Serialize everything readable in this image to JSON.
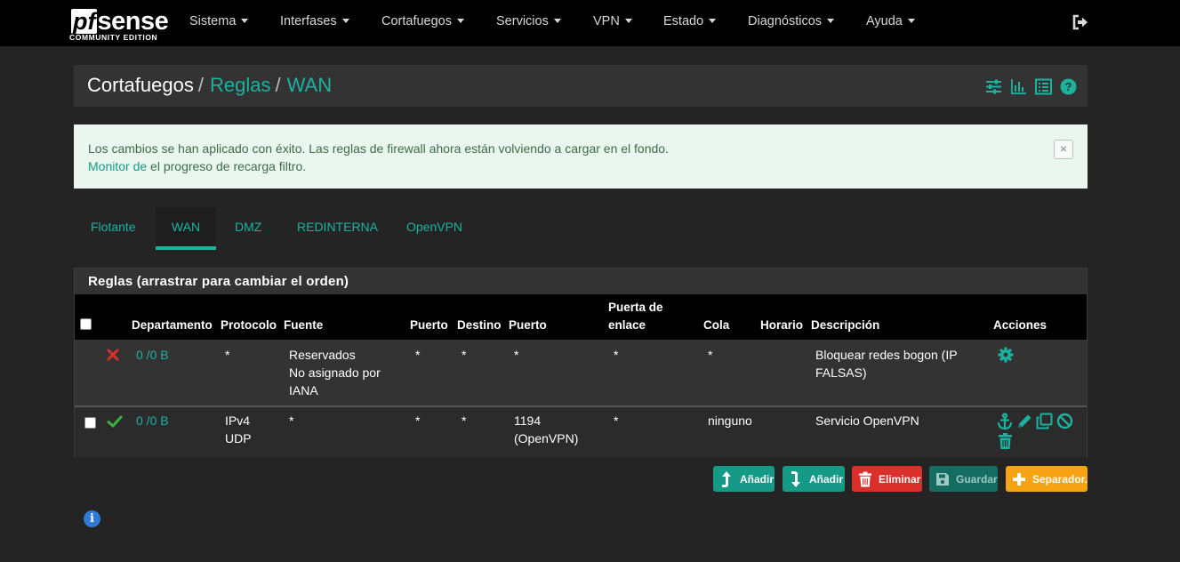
{
  "brand": {
    "logo_pf": "pf",
    "logo_sense": "sense",
    "edition": "COMMUNITY EDITION"
  },
  "nav": {
    "items": [
      "Sistema",
      "Interfases",
      "Cortafuegos",
      "Servicios",
      "VPN",
      "Estado",
      "Diagnósticos",
      "Ayuda"
    ],
    "logout_icon": "logout-icon"
  },
  "breadcrumb": {
    "root": "Cortafuegos",
    "sep": "/",
    "level2": "Reglas",
    "level3": "WAN",
    "icons": [
      "sliders-icon",
      "bar-chart-icon",
      "list-icon",
      "help-icon"
    ]
  },
  "alert": {
    "line1": "Los cambios se han aplicado con éxito. Las reglas de firewall ahora están volviendo a cargar en el fondo.",
    "link": "Monitor de",
    "line2_rest": " el progreso de recarga filtro.",
    "close": "×"
  },
  "tabs": [
    "Flotante",
    "WAN",
    "DMZ",
    "REDINTERNA",
    "OpenVPN"
  ],
  "active_tab": "WAN",
  "panel": {
    "title": "Reglas (arrastrar para cambiar el orden)",
    "headers": {
      "departamento": "Departamento",
      "protocolo": "Protocolo",
      "fuente": "Fuente",
      "puerto1": "Puerto",
      "destino": "Destino",
      "puerto2": "Puerto",
      "gateway_l1": "Puerta de",
      "gateway_l2": "enlace",
      "cola": "Cola",
      "horario": "Horario",
      "descripcion": "Descripción",
      "acciones": "Acciones"
    },
    "rows": [
      {
        "status": "block",
        "states": "0 /0 B",
        "protocol_l1": "*",
        "protocol_l2": "",
        "source_l1": "Reservados",
        "source_l2": "No asignado por",
        "source_l3": "IANA",
        "port": "*",
        "destination": "*",
        "dest_port_l1": "*",
        "dest_port_l2": "",
        "gateway": "*",
        "queue": "*",
        "schedule": "",
        "desc_l1": "Bloquear redes bogon (IP",
        "desc_l2": "FALSAS)",
        "actions": [
          "gear-icon"
        ]
      },
      {
        "status": "pass",
        "states": "0 /0 B",
        "protocol_l1": "IPv4",
        "protocol_l2": "UDP",
        "source_l1": "*",
        "source_l2": "",
        "source_l3": "",
        "port": "*",
        "destination": "*",
        "dest_port_l1": "1194",
        "dest_port_l2": "(OpenVPN)",
        "gateway": "*",
        "queue": "ninguno",
        "schedule": "",
        "desc_l1": "Servicio OpenVPN",
        "desc_l2": "",
        "actions": [
          "anchor-icon",
          "pencil-icon",
          "copy-icon",
          "disable-icon",
          "trash-icon"
        ]
      }
    ]
  },
  "buttons": {
    "add_top": "Añadir",
    "add_bottom": "Añadir",
    "delete": "Eliminar",
    "save": "Guardar",
    "separator": "Separador."
  },
  "colors": {
    "accent": "#1bb3a0",
    "danger": "#d9302b",
    "warning": "#f6a314",
    "success": "#3cb043",
    "info": "#2f7bd2"
  }
}
